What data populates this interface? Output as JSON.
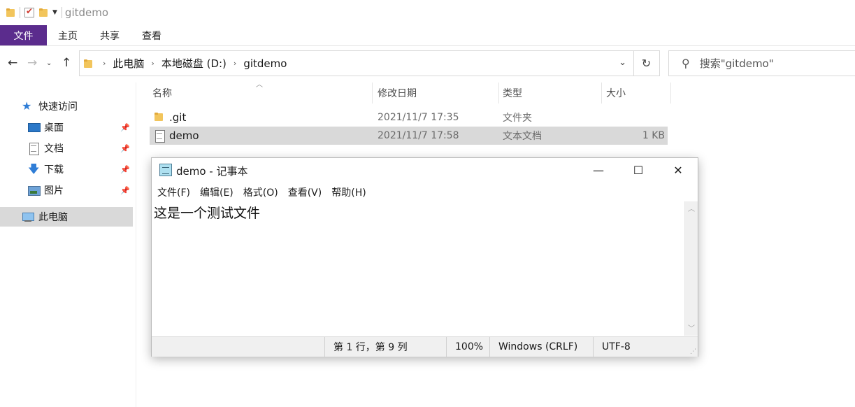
{
  "window": {
    "title": "gitdemo"
  },
  "ribbon": {
    "tabs": [
      "文件",
      "主页",
      "共享",
      "查看"
    ]
  },
  "address": {
    "crumbs": [
      "此电脑",
      "本地磁盘 (D:)",
      "gitdemo"
    ],
    "search_placeholder": "搜索\"gitdemo\""
  },
  "sidebar": {
    "items": [
      {
        "label": "快速访问",
        "icon": "star-icon"
      },
      {
        "label": "桌面",
        "icon": "desktop-icon",
        "pinned": true
      },
      {
        "label": "文档",
        "icon": "documents-icon",
        "pinned": true
      },
      {
        "label": "下载",
        "icon": "download-icon",
        "pinned": true
      },
      {
        "label": "图片",
        "icon": "pictures-icon",
        "pinned": true
      },
      {
        "label": "此电脑",
        "icon": "this-pc-icon",
        "selected": true
      }
    ]
  },
  "filelist": {
    "columns": [
      "名称",
      "修改日期",
      "类型",
      "大小"
    ],
    "rows": [
      {
        "name": ".git",
        "date": "2021/11/7 17:35",
        "type": "文件夹",
        "size": "",
        "icon": "folder-icon"
      },
      {
        "name": "demo",
        "date": "2021/11/7 17:58",
        "type": "文本文档",
        "size": "1 KB",
        "icon": "text-file-icon",
        "selected": true
      }
    ]
  },
  "notepad": {
    "title": "demo - 记事本",
    "menu": [
      "文件(F)",
      "编辑(E)",
      "格式(O)",
      "查看(V)",
      "帮助(H)"
    ],
    "content": "这是一个测试文件",
    "status": {
      "position": "第 1 行，第 9 列",
      "zoom": "100%",
      "line_ending": "Windows (CRLF)",
      "encoding": "UTF-8"
    }
  },
  "colors": {
    "file_tab": "#5b2c8d",
    "selection": "#d9d9d9",
    "accent_blue": "#2f7dd6"
  }
}
